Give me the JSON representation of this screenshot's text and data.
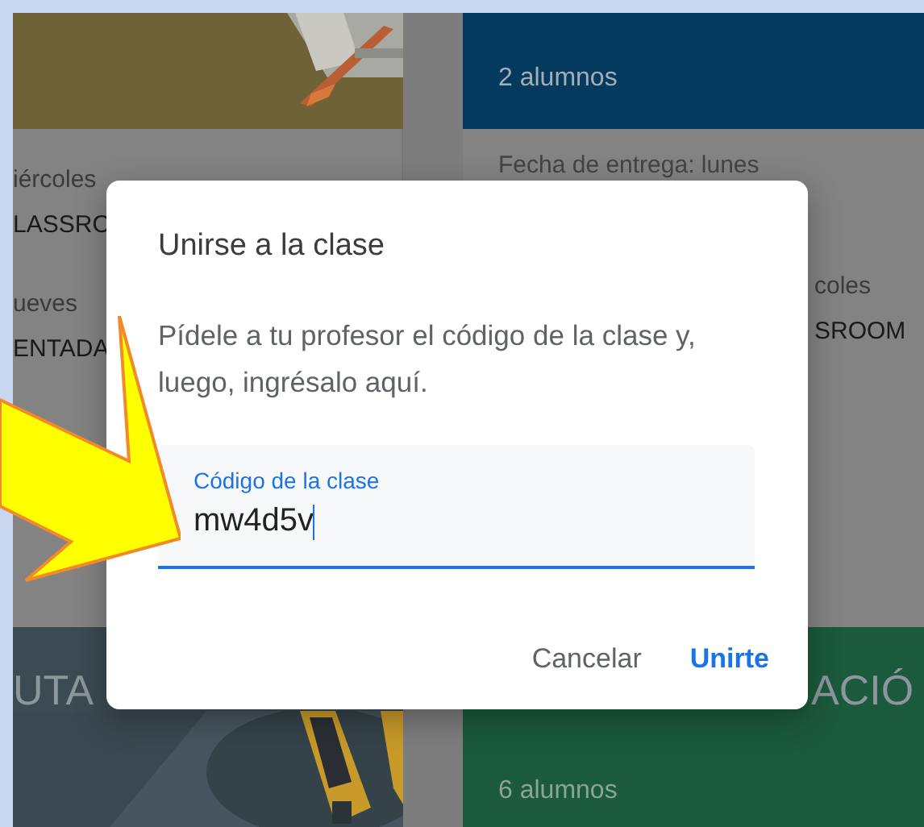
{
  "background": {
    "top_right_card": {
      "students": "2 alumnos"
    },
    "left_details": [
      "iércoles",
      "LASSRO",
      "ueves",
      "ENTADA"
    ],
    "right_details": {
      "due": "Fecha de entrega: lunes",
      "lines": [
        "coles",
        "SROOM"
      ]
    },
    "bottom_left_card": {
      "title": "UTA"
    },
    "bottom_right_card": {
      "title": "ACIÓ",
      "students": "6 alumnos"
    }
  },
  "dialog": {
    "title": "Unirse a la clase",
    "message": "Pídele a tu profesor el código de la clase y, luego, ingrésalo aquí.",
    "field": {
      "label": "Código de la clase",
      "value": "mw4d5v",
      "focused": true
    },
    "buttons": [
      {
        "label": "Cancelar",
        "kind": "secondary"
      },
      {
        "label": "Unirte",
        "kind": "primary"
      }
    ]
  }
}
